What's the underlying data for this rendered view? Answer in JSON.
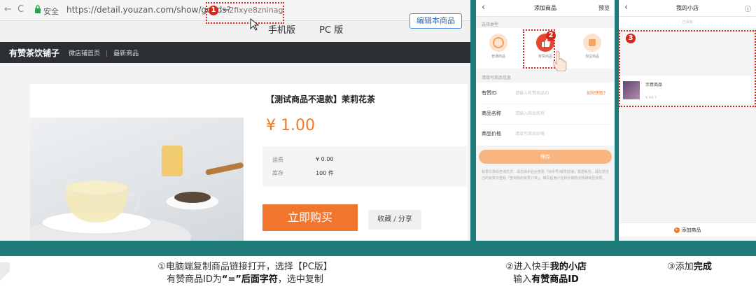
{
  "browser": {
    "secure_label": "安全",
    "url": "https://detail.youzan.com/show/goods?",
    "url_tail": "=2fixye8zninag",
    "step_badge": "1",
    "view_mobile": "手机版",
    "view_pc": "PC 版",
    "edit_button": "编辑本商品",
    "shop_name": "有赞茶饮铺子",
    "shop_nav_home": "微店铺首页",
    "shop_nav_all": "最新商品",
    "product_title": "【测试商品不退款】茉莉花茶",
    "price": "¥ 1.00",
    "info_label_1": "运费",
    "info_value_1": "¥ 0.00",
    "info_label_2": "库存",
    "info_value_2": "100 件",
    "buy_button": "立即购买",
    "share_button": "收藏 / 分享"
  },
  "phone_add": {
    "title": "添加商品",
    "right_action": "预览",
    "section_type": "选择类型",
    "types": [
      {
        "label": "普通商品",
        "color": "#f5a25a"
      },
      {
        "label": "有赞商品",
        "color": "#e8452e"
      },
      {
        "label": "淘宝商品",
        "color": "#f5a25a"
      }
    ],
    "step_badge": "2",
    "section_info": "请填写商品信息",
    "field_id": "有赞ID",
    "field_id_ph": "请输入有赞商品ID",
    "field_id_link": "如何获取?",
    "field_name": "商品名称",
    "field_name_ph": "请输入商品名称",
    "field_price": "商品价格",
    "field_price_ph": "请填写商品价格",
    "save_button": "保存",
    "note": "有赞订单的查询方式：请在快手后台查看「快手号/有赞店铺」发送私信，请在您自己的有赞中查看「查询我的有赞订单」。填写后用户在快手端购买将跳转至有赞。"
  },
  "phone_shop": {
    "title": "我的小店",
    "tab": "已添加",
    "step_badge": "3",
    "item_name": "示意商品",
    "item_price": "¥ 44.7",
    "add_button": "添加商品"
  },
  "captions": {
    "c1_line1": "①电脑端复制商品链接打开，选择【PC版】",
    "c1_line2_pre": "有赞商品ID为",
    "c1_line2_bold": "“=”后面字符",
    "c1_line2_post": "，选中复制",
    "c2_line1_pre": "②进入快手",
    "c2_line1_bold": "我的小店",
    "c2_line2_pre": "输入",
    "c2_line2_bold": "有赞商品ID",
    "c3_pre": "③添加",
    "c3_bold": "完成"
  },
  "colors": {
    "accent_orange": "#f07a24",
    "highlight_red": "#d9261c",
    "frame_teal": "#1f7a7a"
  }
}
